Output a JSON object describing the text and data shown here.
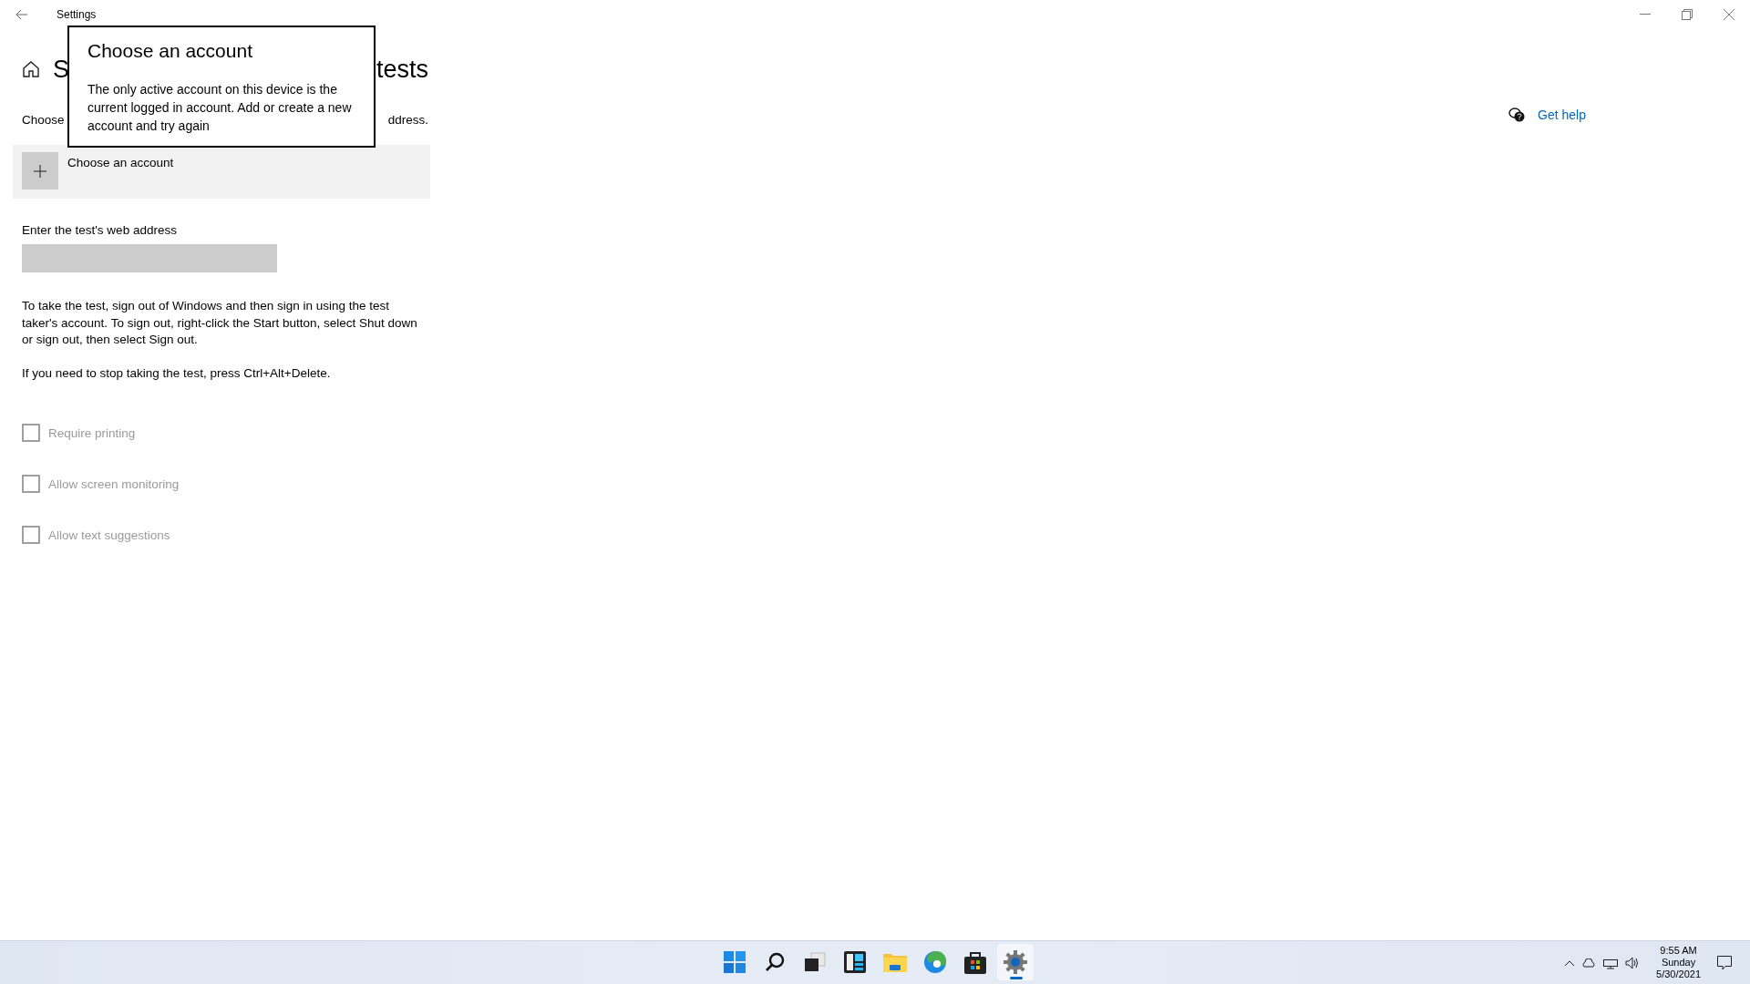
{
  "window": {
    "title": "Settings"
  },
  "page": {
    "heading_fragments": [
      "S",
      "tests"
    ],
    "description_fragments": [
      "Choose",
      "ddress."
    ]
  },
  "account_picker": {
    "label": "Choose an account"
  },
  "web_address": {
    "label": "Enter the test's web address"
  },
  "instructions": [
    "To take the test, sign out of Windows and then sign in using the test taker's account. To sign out, right-click the Start button, select Shut down or sign out, then select Sign out.",
    "If you need to stop taking the test, press Ctrl+Alt+Delete."
  ],
  "options": [
    {
      "label": "Require printing",
      "checked": false,
      "disabled": true
    },
    {
      "label": "Allow screen monitoring",
      "checked": false,
      "disabled": true
    },
    {
      "label": "Allow text suggestions",
      "checked": false,
      "disabled": true
    }
  ],
  "help_link": "Get help",
  "dialog": {
    "title": "Choose an account",
    "message": "The only active account on this device is the current logged in account. Add or create a new account and try again"
  },
  "taskbar": {
    "apps": [
      {
        "kind": "start",
        "selected": false
      },
      {
        "kind": "search",
        "selected": false
      },
      {
        "kind": "taskview",
        "selected": false
      },
      {
        "kind": "widgets",
        "selected": false
      },
      {
        "kind": "folder",
        "selected": false
      },
      {
        "kind": "edge",
        "selected": false
      },
      {
        "kind": "store",
        "selected": false
      },
      {
        "kind": "settings",
        "selected": true
      }
    ],
    "clock": {
      "time": "9:55 AM",
      "day": "Sunday",
      "date": "5/30/2021"
    }
  }
}
